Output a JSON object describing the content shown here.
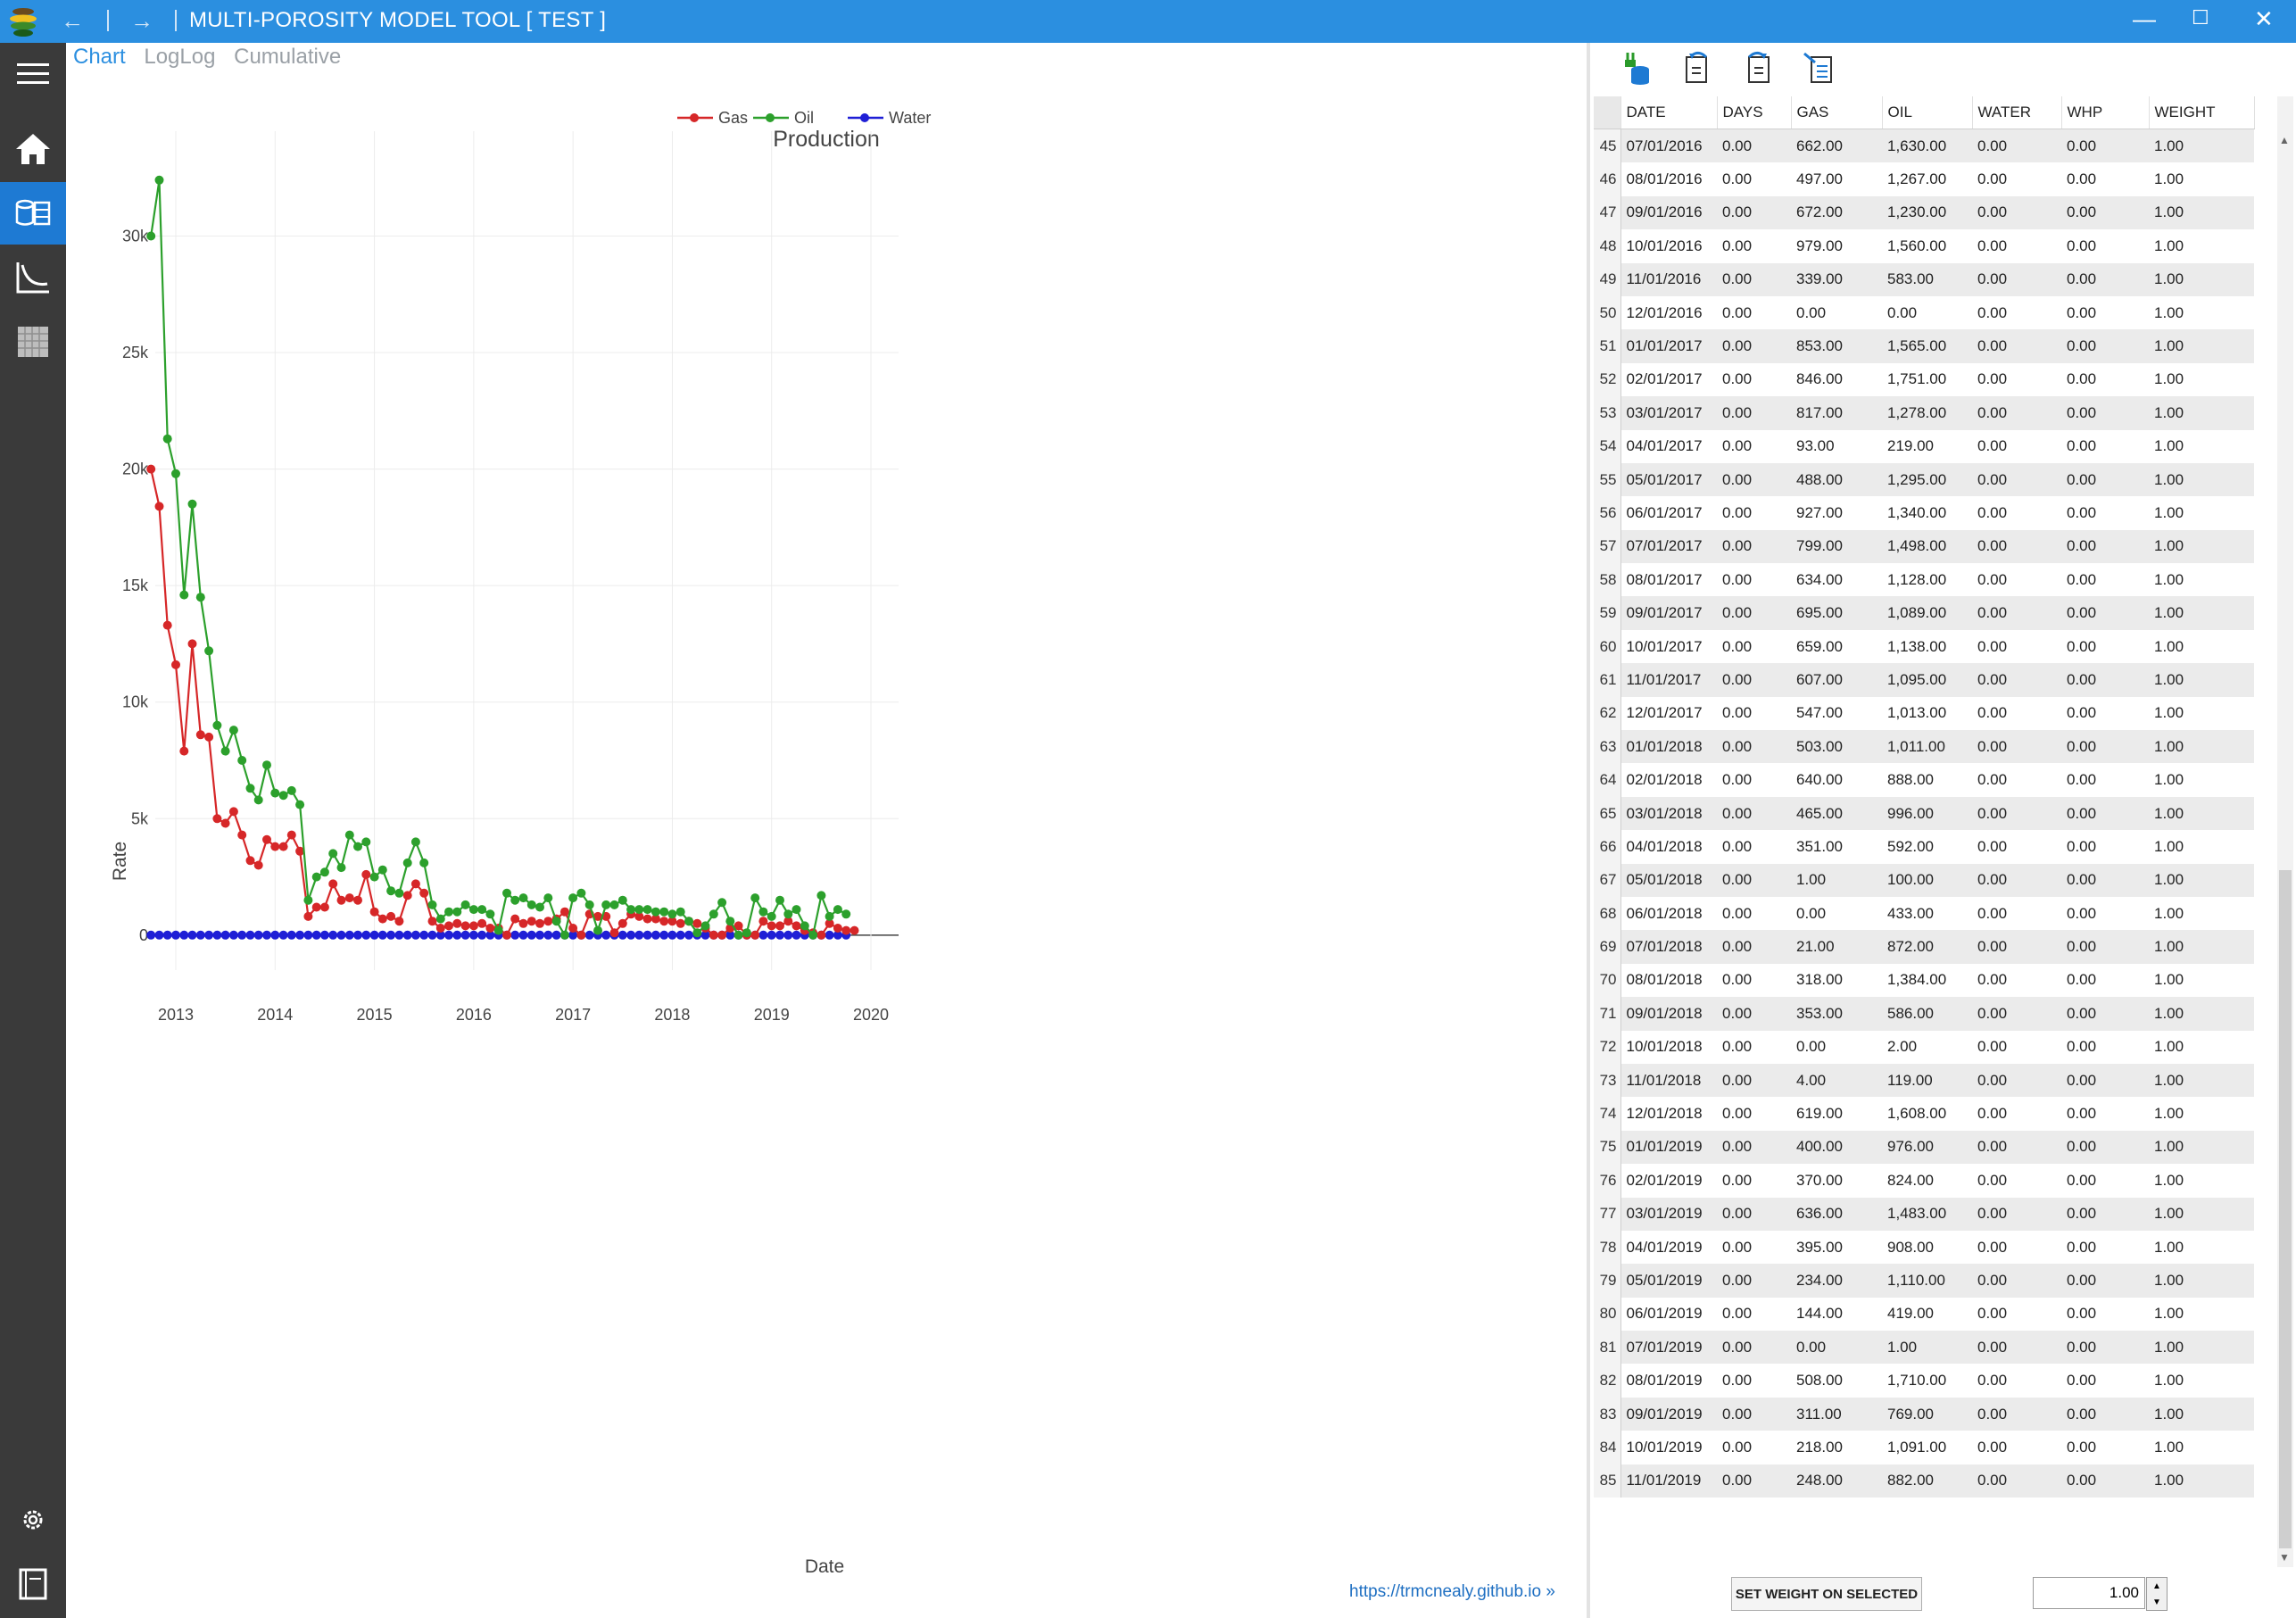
{
  "app": {
    "title": "MULTI-POROSITY MODEL TOOL [ TEST ]",
    "link_text": "https://trmcnealy.github.io »"
  },
  "sidebar": {
    "items": [
      "menu-icon",
      "home-icon",
      "data-table-icon",
      "curve-icon",
      "grid-icon",
      "gear-icon",
      "notebook-icon"
    ]
  },
  "chart_tabs": [
    {
      "label": "Chart",
      "active": true
    },
    {
      "label": "LogLog",
      "active": false
    },
    {
      "label": "Cumulative",
      "active": false
    }
  ],
  "toolbar": {
    "icons": [
      "import-data-icon",
      "undo-icon",
      "redo-icon",
      "export-icon"
    ]
  },
  "grid": {
    "columns": [
      "DATE",
      "DAYS",
      "GAS",
      "OIL",
      "WATER",
      "WHP",
      "WEIGHT"
    ],
    "rows": [
      [
        "45",
        "07/01/2016",
        "0.00",
        "662.00",
        "1,630.00",
        "0.00",
        "0.00",
        "1.00"
      ],
      [
        "46",
        "08/01/2016",
        "0.00",
        "497.00",
        "1,267.00",
        "0.00",
        "0.00",
        "1.00"
      ],
      [
        "47",
        "09/01/2016",
        "0.00",
        "672.00",
        "1,230.00",
        "0.00",
        "0.00",
        "1.00"
      ],
      [
        "48",
        "10/01/2016",
        "0.00",
        "979.00",
        "1,560.00",
        "0.00",
        "0.00",
        "1.00"
      ],
      [
        "49",
        "11/01/2016",
        "0.00",
        "339.00",
        "583.00",
        "0.00",
        "0.00",
        "1.00"
      ],
      [
        "50",
        "12/01/2016",
        "0.00",
        "0.00",
        "0.00",
        "0.00",
        "0.00",
        "1.00"
      ],
      [
        "51",
        "01/01/2017",
        "0.00",
        "853.00",
        "1,565.00",
        "0.00",
        "0.00",
        "1.00"
      ],
      [
        "52",
        "02/01/2017",
        "0.00",
        "846.00",
        "1,751.00",
        "0.00",
        "0.00",
        "1.00"
      ],
      [
        "53",
        "03/01/2017",
        "0.00",
        "817.00",
        "1,278.00",
        "0.00",
        "0.00",
        "1.00"
      ],
      [
        "54",
        "04/01/2017",
        "0.00",
        "93.00",
        "219.00",
        "0.00",
        "0.00",
        "1.00"
      ],
      [
        "55",
        "05/01/2017",
        "0.00",
        "488.00",
        "1,295.00",
        "0.00",
        "0.00",
        "1.00"
      ],
      [
        "56",
        "06/01/2017",
        "0.00",
        "927.00",
        "1,340.00",
        "0.00",
        "0.00",
        "1.00"
      ],
      [
        "57",
        "07/01/2017",
        "0.00",
        "799.00",
        "1,498.00",
        "0.00",
        "0.00",
        "1.00"
      ],
      [
        "58",
        "08/01/2017",
        "0.00",
        "634.00",
        "1,128.00",
        "0.00",
        "0.00",
        "1.00"
      ],
      [
        "59",
        "09/01/2017",
        "0.00",
        "695.00",
        "1,089.00",
        "0.00",
        "0.00",
        "1.00"
      ],
      [
        "60",
        "10/01/2017",
        "0.00",
        "659.00",
        "1,138.00",
        "0.00",
        "0.00",
        "1.00"
      ],
      [
        "61",
        "11/01/2017",
        "0.00",
        "607.00",
        "1,095.00",
        "0.00",
        "0.00",
        "1.00"
      ],
      [
        "62",
        "12/01/2017",
        "0.00",
        "547.00",
        "1,013.00",
        "0.00",
        "0.00",
        "1.00"
      ],
      [
        "63",
        "01/01/2018",
        "0.00",
        "503.00",
        "1,011.00",
        "0.00",
        "0.00",
        "1.00"
      ],
      [
        "64",
        "02/01/2018",
        "0.00",
        "640.00",
        "888.00",
        "0.00",
        "0.00",
        "1.00"
      ],
      [
        "65",
        "03/01/2018",
        "0.00",
        "465.00",
        "996.00",
        "0.00",
        "0.00",
        "1.00"
      ],
      [
        "66",
        "04/01/2018",
        "0.00",
        "351.00",
        "592.00",
        "0.00",
        "0.00",
        "1.00"
      ],
      [
        "67",
        "05/01/2018",
        "0.00",
        "1.00",
        "100.00",
        "0.00",
        "0.00",
        "1.00"
      ],
      [
        "68",
        "06/01/2018",
        "0.00",
        "0.00",
        "433.00",
        "0.00",
        "0.00",
        "1.00"
      ],
      [
        "69",
        "07/01/2018",
        "0.00",
        "21.00",
        "872.00",
        "0.00",
        "0.00",
        "1.00"
      ],
      [
        "70",
        "08/01/2018",
        "0.00",
        "318.00",
        "1,384.00",
        "0.00",
        "0.00",
        "1.00"
      ],
      [
        "71",
        "09/01/2018",
        "0.00",
        "353.00",
        "586.00",
        "0.00",
        "0.00",
        "1.00"
      ],
      [
        "72",
        "10/01/2018",
        "0.00",
        "0.00",
        "2.00",
        "0.00",
        "0.00",
        "1.00"
      ],
      [
        "73",
        "11/01/2018",
        "0.00",
        "4.00",
        "119.00",
        "0.00",
        "0.00",
        "1.00"
      ],
      [
        "74",
        "12/01/2018",
        "0.00",
        "619.00",
        "1,608.00",
        "0.00",
        "0.00",
        "1.00"
      ],
      [
        "75",
        "01/01/2019",
        "0.00",
        "400.00",
        "976.00",
        "0.00",
        "0.00",
        "1.00"
      ],
      [
        "76",
        "02/01/2019",
        "0.00",
        "370.00",
        "824.00",
        "0.00",
        "0.00",
        "1.00"
      ],
      [
        "77",
        "03/01/2019",
        "0.00",
        "636.00",
        "1,483.00",
        "0.00",
        "0.00",
        "1.00"
      ],
      [
        "78",
        "04/01/2019",
        "0.00",
        "395.00",
        "908.00",
        "0.00",
        "0.00",
        "1.00"
      ],
      [
        "79",
        "05/01/2019",
        "0.00",
        "234.00",
        "1,110.00",
        "0.00",
        "0.00",
        "1.00"
      ],
      [
        "80",
        "06/01/2019",
        "0.00",
        "144.00",
        "419.00",
        "0.00",
        "0.00",
        "1.00"
      ],
      [
        "81",
        "07/01/2019",
        "0.00",
        "0.00",
        "1.00",
        "0.00",
        "0.00",
        "1.00"
      ],
      [
        "82",
        "08/01/2019",
        "0.00",
        "508.00",
        "1,710.00",
        "0.00",
        "0.00",
        "1.00"
      ],
      [
        "83",
        "09/01/2019",
        "0.00",
        "311.00",
        "769.00",
        "0.00",
        "0.00",
        "1.00"
      ],
      [
        "84",
        "10/01/2019",
        "0.00",
        "218.00",
        "1,091.00",
        "0.00",
        "0.00",
        "1.00"
      ],
      [
        "85",
        "11/01/2019",
        "0.00",
        "248.00",
        "882.00",
        "0.00",
        "0.00",
        "1.00"
      ]
    ]
  },
  "controls": {
    "set_weight_label": "SET WEIGHT ON SELECTED",
    "weight_value": "1.00"
  },
  "chart_data": {
    "type": "line",
    "title": "Production",
    "xlabel": "Date",
    "ylabel": "Rate",
    "x_start": "2012-10",
    "x_step": "monthly",
    "xticks": [
      "2013",
      "2014",
      "2015",
      "2016",
      "2017",
      "2018",
      "2019",
      "2020"
    ],
    "yticks": [
      "0",
      "5k",
      "10k",
      "15k",
      "20k",
      "25k",
      "30k"
    ],
    "ylim": [
      -1500,
      34500
    ],
    "grid": true,
    "legend": "top-center",
    "series": [
      {
        "name": "Gas",
        "color": "#d62728",
        "values": [
          20000,
          18400,
          13300,
          11600,
          7900,
          12500,
          8600,
          8500,
          5000,
          4800,
          5300,
          4300,
          3200,
          3000,
          4100,
          3800,
          3800,
          4300,
          3600,
          800,
          1200,
          1200,
          2200,
          1500,
          1600,
          1500,
          2600,
          1000,
          700,
          800,
          600,
          1700,
          2200,
          1800,
          600,
          300,
          400,
          500,
          400,
          400,
          500,
          300,
          300,
          0,
          700,
          500,
          600,
          500,
          600,
          700,
          1000,
          300,
          0,
          900,
          800,
          800,
          100,
          500,
          900,
          800,
          700,
          700,
          600,
          600,
          500,
          600,
          500,
          300,
          0,
          0,
          300,
          400,
          0,
          0,
          600,
          400,
          400,
          600,
          400,
          200,
          100,
          0,
          500,
          300,
          200,
          200
        ]
      },
      {
        "name": "Oil",
        "color": "#2ca02c",
        "values": [
          30000,
          32400,
          21300,
          19800,
          14600,
          18500,
          14500,
          12200,
          9000,
          7900,
          8800,
          7500,
          6300,
          5800,
          7300,
          6100,
          6000,
          6200,
          5600,
          1500,
          2500,
          2700,
          3500,
          2900,
          4300,
          3800,
          4000,
          2500,
          2800,
          1900,
          1800,
          3100,
          4000,
          3100,
          1300,
          700,
          1000,
          1000,
          1300,
          1100,
          1100,
          900,
          200,
          1800,
          1500,
          1600,
          1300,
          1200,
          1600,
          600,
          0,
          1600,
          1800,
          1300,
          200,
          1300,
          1300,
          1500,
          1100,
          1100,
          1100,
          1000,
          1000,
          900,
          1000,
          600,
          100,
          400,
          900,
          1400,
          600,
          0,
          100,
          1600,
          1000,
          800,
          1500,
          900,
          1100,
          400,
          0,
          1700,
          800,
          1100,
          900
        ]
      },
      {
        "name": "Water",
        "color": "#1f1fd6",
        "values": [
          0,
          0,
          0,
          0,
          0,
          0,
          0,
          0,
          0,
          0,
          0,
          0,
          0,
          0,
          0,
          0,
          0,
          0,
          0,
          0,
          0,
          0,
          0,
          0,
          0,
          0,
          0,
          0,
          0,
          0,
          0,
          0,
          0,
          0,
          0,
          0,
          0,
          0,
          0,
          0,
          0,
          0,
          0,
          0,
          0,
          0,
          0,
          0,
          0,
          0,
          0,
          0,
          0,
          0,
          0,
          0,
          0,
          0,
          0,
          0,
          0,
          0,
          0,
          0,
          0,
          0,
          0,
          0,
          0,
          0,
          0,
          0,
          0,
          0,
          0,
          0,
          0,
          0,
          0,
          0,
          0,
          0,
          0,
          0,
          0
        ]
      }
    ]
  }
}
